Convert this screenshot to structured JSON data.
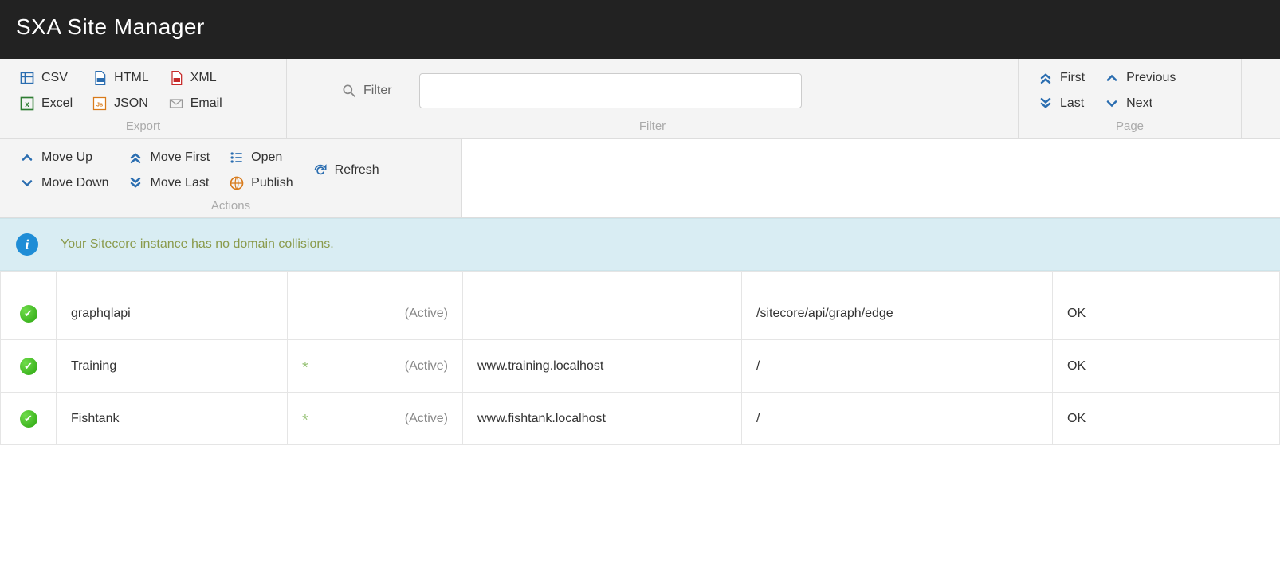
{
  "app": {
    "title": "SXA Site Manager"
  },
  "ribbon": {
    "export": {
      "label": "Export",
      "items": {
        "csv": "CSV",
        "excel": "Excel",
        "html": "HTML",
        "json": "JSON",
        "xml": "XML",
        "email": "Email"
      }
    },
    "filter": {
      "group_label": "Filter",
      "label": "Filter",
      "value": ""
    },
    "page": {
      "label": "Page",
      "first": "First",
      "last": "Last",
      "previous": "Previous",
      "next": "Next"
    },
    "actions": {
      "label": "Actions",
      "move_up": "Move Up",
      "move_down": "Move Down",
      "move_first": "Move First",
      "move_last": "Move Last",
      "open": "Open",
      "publish": "Publish",
      "refresh": "Refresh"
    }
  },
  "info": {
    "message": "Your Sitecore instance has no domain collisions."
  },
  "table": {
    "active_label": "(Active)",
    "rows": [
      {
        "name": "graphqlapi",
        "star": "",
        "host": "",
        "path": "/sitecore/api/graph/edge",
        "status": "OK"
      },
      {
        "name": "Training",
        "star": "*",
        "host": "www.training.localhost",
        "path": "/",
        "status": "OK"
      },
      {
        "name": "Fishtank",
        "star": "*",
        "host": "www.fishtank.localhost",
        "path": "/",
        "status": "OK"
      }
    ]
  }
}
